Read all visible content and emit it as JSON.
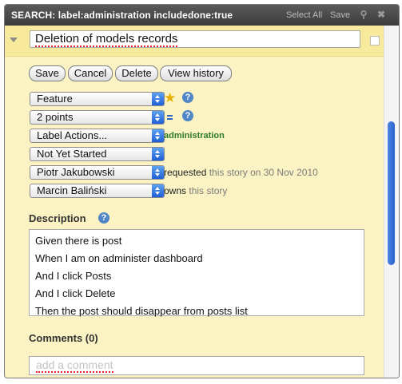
{
  "titlebar": {
    "title": "SEARCH: label:administration includedone:true",
    "select_all": "Select All",
    "save": "Save",
    "pin_icon": "pin-icon",
    "close_icon": "close-icon"
  },
  "story": {
    "name": "Deletion of models records",
    "buttons": {
      "save": "Save",
      "cancel": "Cancel",
      "delete": "Delete",
      "history": "View history"
    },
    "type": "Feature",
    "points": "2 points",
    "label_actions": "Label Actions...",
    "label_value": "administration",
    "state": "Not Yet Started",
    "requester": "Piotr Jakubowski",
    "requested_text": "requested",
    "requested_rest": "this story on 30 Nov 2010",
    "owner": "Marcin Baliński",
    "owns_text": "owns",
    "owns_rest": "this story"
  },
  "description": {
    "heading": "Description",
    "lines": [
      "Given there is post",
      "When I am on administer dashboard",
      "And I click Posts",
      "And I click Delete",
      "Then the post should disappear from posts list"
    ]
  },
  "comments": {
    "heading": "Comments (0)",
    "placeholder": "add a comment"
  },
  "help_glyph": "?",
  "colors": {
    "panel_bg": "#fbf3c3",
    "titlebar": "#4a4a4a",
    "accent": "#2b62cf",
    "label_green": "#2f7a2f"
  }
}
